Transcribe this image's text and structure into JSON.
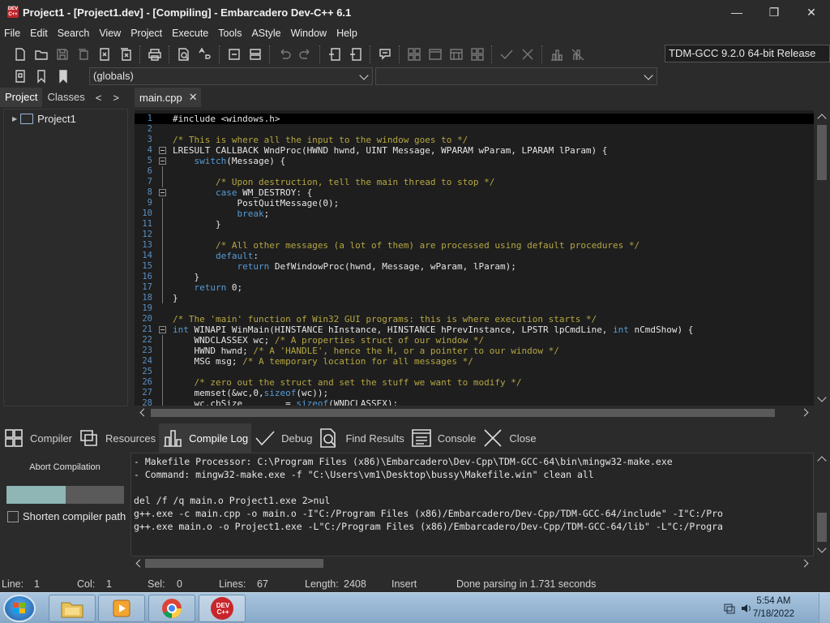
{
  "window": {
    "title": "Project1 - [Project1.dev] - [Compiling] - Embarcadero Dev-C++ 6.1",
    "app_icon_text": "DEV C++",
    "controls": {
      "minimize": "—",
      "maximize": "❐",
      "close": "✕"
    }
  },
  "menu": [
    "File",
    "Edit",
    "Search",
    "View",
    "Project",
    "Execute",
    "Tools",
    "AStyle",
    "Window",
    "Help"
  ],
  "toolbar": {
    "compiler": "TDM-GCC 9.2.0 64-bit Release",
    "scope_combo": "(globals)",
    "function_combo": ""
  },
  "left_panel": {
    "tabs": [
      "Project",
      "Classes"
    ],
    "active_tab": "Project",
    "nav_prev": "<",
    "nav_next": ">",
    "tree": [
      {
        "label": "Project1",
        "expander": "▶"
      }
    ]
  },
  "editor": {
    "tab_label": "main.cpp",
    "tab_close": "✕",
    "current_line": 1,
    "lines": [
      {
        "n": "1",
        "text": "#include <windows.h>"
      },
      {
        "n": "2",
        "text": ""
      },
      {
        "n": "3",
        "text": "/* This is where all the input to the window goes to */"
      },
      {
        "n": "4",
        "text": "LRESULT CALLBACK WndProc(HWND hwnd, UINT Message, WPARAM wParam, LPARAM lParam) {"
      },
      {
        "n": "5",
        "text": "    switch(Message) {"
      },
      {
        "n": "6",
        "text": ""
      },
      {
        "n": "7",
        "text": "        /* Upon destruction, tell the main thread to stop */"
      },
      {
        "n": "8",
        "text": "        case WM_DESTROY: {"
      },
      {
        "n": "9",
        "text": "            PostQuitMessage(0);"
      },
      {
        "n": "10",
        "text": "            break;"
      },
      {
        "n": "11",
        "text": "        }"
      },
      {
        "n": "12",
        "text": ""
      },
      {
        "n": "13",
        "text": "        /* All other messages (a lot of them) are processed using default procedures */"
      },
      {
        "n": "14",
        "text": "        default:"
      },
      {
        "n": "15",
        "text": "            return DefWindowProc(hwnd, Message, wParam, lParam);"
      },
      {
        "n": "16",
        "text": "    }"
      },
      {
        "n": "17",
        "text": "    return 0;"
      },
      {
        "n": "18",
        "text": "}"
      },
      {
        "n": "19",
        "text": ""
      },
      {
        "n": "20",
        "text": "/* The 'main' function of Win32 GUI programs: this is where execution starts */"
      },
      {
        "n": "21",
        "text": "int WINAPI WinMain(HINSTANCE hInstance, HINSTANCE hPrevInstance, LPSTR lpCmdLine, int nCmdShow) {"
      },
      {
        "n": "22",
        "text": "    WNDCLASSEX wc; /* A properties struct of our window */"
      },
      {
        "n": "23",
        "text": "    HWND hwnd; /* A 'HANDLE', hence the H, or a pointer to our window */"
      },
      {
        "n": "24",
        "text": "    MSG msg; /* A temporary location for all messages */"
      },
      {
        "n": "25",
        "text": ""
      },
      {
        "n": "26",
        "text": "    /* zero out the struct and set the stuff we want to modify */"
      },
      {
        "n": "27",
        "text": "    memset(&wc,0,sizeof(wc));"
      },
      {
        "n": "28",
        "text": "    wc.cbSize        = sizeof(WNDCLASSEX);"
      }
    ]
  },
  "bottom_tabs": [
    {
      "label": "Compiler",
      "icon": "grid-icon"
    },
    {
      "label": "Resources",
      "icon": "resources-icon"
    },
    {
      "label": "Compile Log",
      "icon": "bar-chart-icon",
      "active": true
    },
    {
      "label": "Debug",
      "icon": "check-icon"
    },
    {
      "label": "Find Results",
      "icon": "find-icon"
    },
    {
      "label": "Console",
      "icon": "console-icon"
    },
    {
      "label": "Close",
      "icon": "close-icon"
    }
  ],
  "compile_panel": {
    "abort_label": "Abort Compilation",
    "progress": 0.5,
    "shorten_label": "Shorten compiler path",
    "shorten_checked": false,
    "log": [
      "- Makefile Processor: C:\\Program Files (x86)\\Embarcadero\\Dev-Cpp\\TDM-GCC-64\\bin\\mingw32-make.exe",
      "- Command: mingw32-make.exe -f \"C:\\Users\\vm1\\Desktop\\bussy\\Makefile.win\" clean all",
      "",
      "del /f /q main.o Project1.exe 2>nul",
      "g++.exe -c main.cpp -o main.o -I\"C:/Program Files (x86)/Embarcadero/Dev-Cpp/TDM-GCC-64/include\" -I\"C:/Pro",
      "g++.exe main.o -o Project1.exe -L\"C:/Program Files (x86)/Embarcadero/Dev-Cpp/TDM-GCC-64/lib\" -L\"C:/Progra"
    ]
  },
  "status": {
    "line_label": "Line:",
    "line": "1",
    "col_label": "Col:",
    "col": "1",
    "sel_label": "Sel:",
    "sel": "0",
    "lines_label": "Lines:",
    "lines": "67",
    "length_label": "Length:",
    "length": "2408",
    "mode": "Insert",
    "message": "Done parsing in 1.731 seconds"
  },
  "taskbar": {
    "apps": [
      "file-explorer-icon",
      "media-player-icon",
      "chrome-icon",
      "devcpp-icon"
    ],
    "devcpp_text": "DEV C++",
    "time": "5:54 AM",
    "date": "7/18/2022"
  },
  "colors": {
    "background": "#2b2b2b",
    "editor_bg": "#1e1e1e",
    "keyword": "#569cd6",
    "comment": "#b5a642",
    "line_number": "#5a8fc0",
    "progress_fill": "#8fb5b5"
  }
}
